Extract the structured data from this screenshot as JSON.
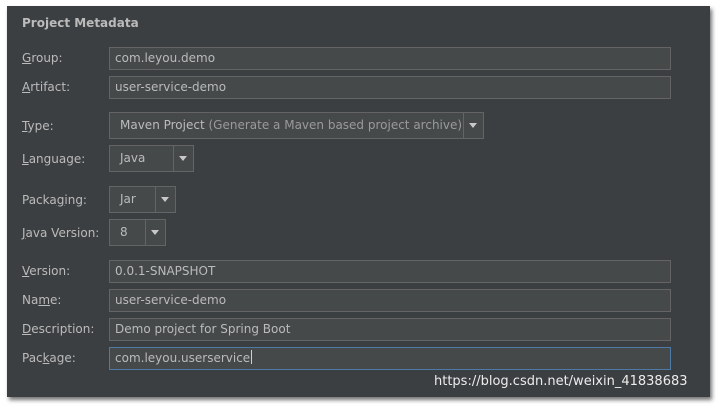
{
  "section_title": "Project Metadata",
  "group": {
    "label_ul": "G",
    "label_rest": "roup:",
    "value": "com.leyou.demo"
  },
  "artifact": {
    "label_ul": "A",
    "label_rest": "rtifact:",
    "value": "user-service-demo"
  },
  "type": {
    "label_ul": "T",
    "label_rest": "ype:",
    "value": "Maven Project",
    "hint": "(Generate a Maven based project archive)"
  },
  "language": {
    "label_ul": "L",
    "label_rest": "anguage:",
    "value": "Java"
  },
  "packaging": {
    "label_pre": "Packa",
    "label_ul": "g",
    "label_rest": "ing:",
    "value": "Jar"
  },
  "java_version": {
    "label_ul": "J",
    "label_rest": "ava Version:",
    "value": "8"
  },
  "version": {
    "label_ul": "V",
    "label_rest": "ersion:",
    "value": "0.0.1-SNAPSHOT"
  },
  "name": {
    "label_pre": "Na",
    "label_ul": "m",
    "label_rest": "e:",
    "value": "user-service-demo"
  },
  "description": {
    "label_ul": "D",
    "label_rest": "escription:",
    "value": "Demo project for Spring Boot"
  },
  "package": {
    "label_pre": "Pac",
    "label_ul": "k",
    "label_rest": "age:",
    "value": "com.leyou.userservice"
  },
  "watermark": "https://blog.csdn.net/weixin_41838683"
}
